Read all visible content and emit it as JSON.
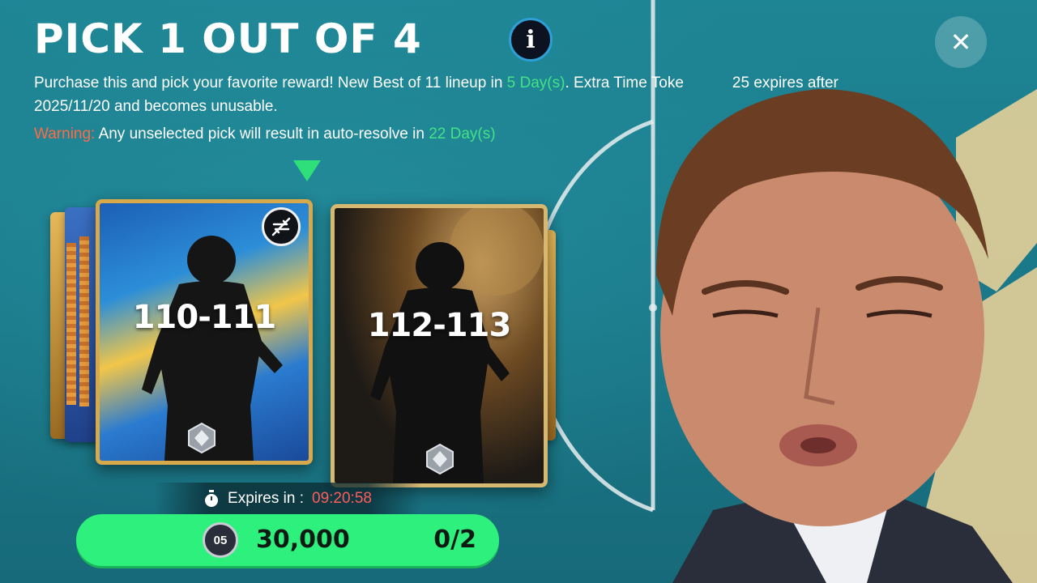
{
  "header": {
    "title": "PICK 1 OUT OF 4",
    "info_glyph": "i",
    "close_glyph": "✕"
  },
  "description": {
    "part1": "Purchase this and pick your favorite reward! New Best of 11 lineup in ",
    "highlight1": "5 Day(s)",
    "part2": ". Extra Time Toke",
    "part3": "25 expires after 2025/11/20 and becomes unusable."
  },
  "warning": {
    "label": "Warning:",
    "text": "Any unselected pick will result in auto-resolve in ",
    "highlight": "22 Day(s)"
  },
  "cards": [
    {
      "rating": "110-111",
      "selected": true,
      "theme": "blue-gold"
    },
    {
      "rating": "112-113",
      "selected": false,
      "theme": "black-gold"
    }
  ],
  "timer": {
    "label": "Expires in :",
    "value": "09:20:58"
  },
  "purchase": {
    "coin_label": "05",
    "price": "30,000",
    "counter": "0/2"
  },
  "icons": [
    "info-icon",
    "close-icon",
    "swap-disabled-icon",
    "stopwatch-icon",
    "coin-icon",
    "rank-gem-icon"
  ],
  "colors": {
    "accent_green": "#2ef07d",
    "highlight_green": "#42e384",
    "warning_red": "#ff6a45",
    "timer_red": "#ff5c5c",
    "background": "#1c7d8c"
  }
}
